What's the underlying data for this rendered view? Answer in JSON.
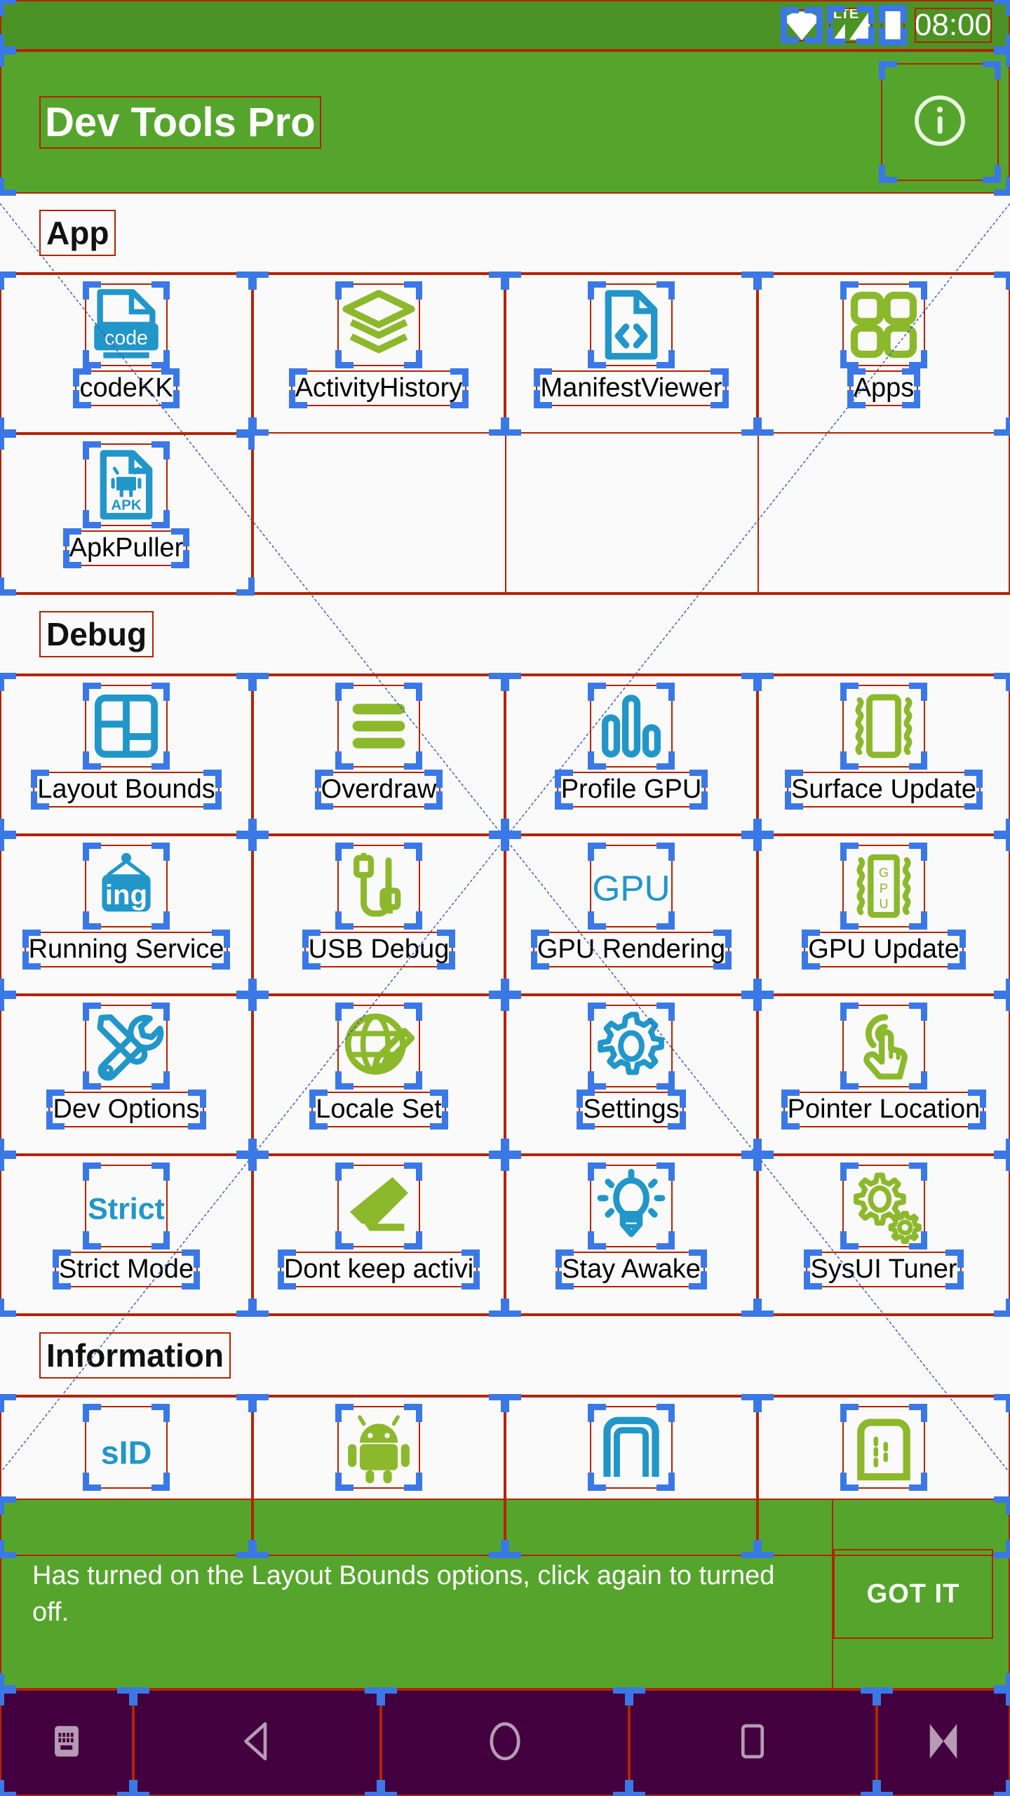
{
  "statusbar": {
    "wifi_icon": "wifi-icon",
    "signal_icon": "lte-signal-icon",
    "lte_label": "LTE",
    "battery_icon": "battery-icon",
    "clock": "08:00"
  },
  "appbar": {
    "title": "Dev Tools Pro",
    "info_icon": "info-icon"
  },
  "sections": [
    {
      "title": "App",
      "items": [
        {
          "label": "codeKK",
          "icon": "code-file-icon",
          "color": "#2196c9"
        },
        {
          "label": "ActivityHistory",
          "icon": "layers-icon",
          "color": "#8cb82b"
        },
        {
          "label": "ManifestViewer",
          "icon": "code-document-icon",
          "color": "#2196c9"
        },
        {
          "label": "Apps",
          "icon": "apps-grid-icon",
          "color": "#8cb82b"
        },
        {
          "label": "ApkPuller",
          "icon": "apk-file-icon",
          "color": "#2196c9"
        }
      ]
    },
    {
      "title": "Debug",
      "items": [
        {
          "label": "Layout Bounds",
          "icon": "layout-bounds-icon",
          "color": "#2196c9"
        },
        {
          "label": "Overdraw",
          "icon": "overdraw-bars-icon",
          "color": "#8cb82b"
        },
        {
          "label": "Profile GPU",
          "icon": "profile-gpu-icon",
          "color": "#2196c9"
        },
        {
          "label": "Surface Update",
          "icon": "surface-update-icon",
          "color": "#8cb82b"
        },
        {
          "label": "Running Service",
          "icon": "running-service-icon",
          "color": "#2196c9"
        },
        {
          "label": "USB Debug",
          "icon": "usb-cable-icon",
          "color": "#8cb82b"
        },
        {
          "label": "GPU Rendering",
          "icon": "gpu-text-icon",
          "color": "#2196c9"
        },
        {
          "label": "GPU Update",
          "icon": "gpu-chip-icon",
          "color": "#8cb82b"
        },
        {
          "label": "Dev Options",
          "icon": "tools-icon",
          "color": "#2196c9"
        },
        {
          "label": "Locale Set",
          "icon": "globe-pencil-icon",
          "color": "#8cb82b"
        },
        {
          "label": "Settings",
          "icon": "gear-icon",
          "color": "#2196c9"
        },
        {
          "label": "Pointer Location",
          "icon": "touch-pointer-icon",
          "color": "#8cb82b"
        },
        {
          "label": "Strict Mode",
          "icon": "strict-text-icon",
          "color": "#2196c9"
        },
        {
          "label": "Dont keep activi",
          "icon": "eraser-icon",
          "color": "#8cb82b"
        },
        {
          "label": "Stay Awake",
          "icon": "lightbulb-icon",
          "color": "#2196c9"
        },
        {
          "label": "SysUI Tuner",
          "icon": "gears-icon",
          "color": "#8cb82b"
        }
      ]
    },
    {
      "title": "Information",
      "items": [
        {
          "label": "",
          "icon": "sid-icon",
          "color": "#2196c9"
        },
        {
          "label": "",
          "icon": "android-robot-icon",
          "color": "#8cb82b"
        },
        {
          "label": "",
          "icon": "screen-outline-icon",
          "color": "#2196c9"
        },
        {
          "label": "",
          "icon": "device-dashed-icon",
          "color": "#8cb82b"
        }
      ]
    }
  ],
  "snackbar": {
    "message": "Has turned on the Layout Bounds options, click again to turned off.",
    "action": "GOT IT"
  },
  "navbar": {
    "buttons": [
      {
        "icon": "keyboard-icon"
      },
      {
        "icon": "back-icon"
      },
      {
        "icon": "home-icon"
      },
      {
        "icon": "recents-icon"
      },
      {
        "icon": "hide-keyboard-icon"
      }
    ]
  },
  "theme": {
    "status_green": "#4b9324",
    "appbar_green": "#55a52c",
    "blue_icon": "#2196c9",
    "green_icon": "#8cb82b",
    "navbar_purple": "#42003f",
    "bounds_red": "#b32400",
    "bounds_blue": "#3b78e7"
  }
}
